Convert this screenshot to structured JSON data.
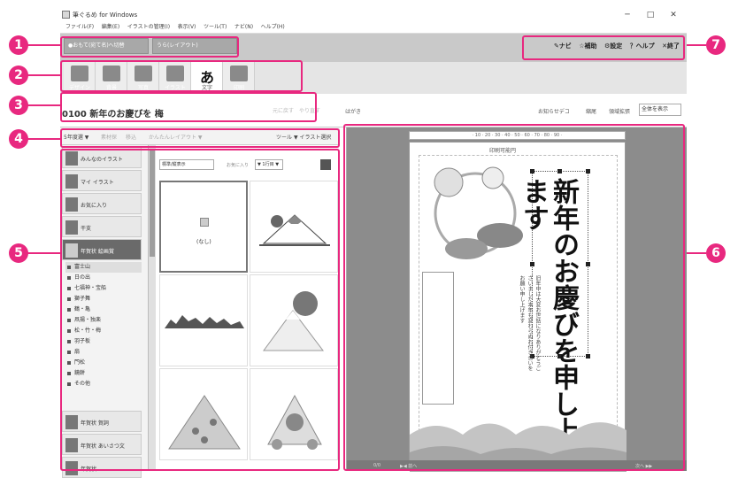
{
  "window": {
    "title": "筆ぐるめ for Windows",
    "min": "─",
    "max": "□",
    "close": "✕"
  },
  "menu": [
    "ファイル(F)",
    "編集(E)",
    "イラストの管理(I)",
    "表示(V)",
    "ツール(T)",
    "ナビ(N)",
    "ヘルプ(H)"
  ],
  "mode": {
    "front": "●おもて(宛て名)へ切替",
    "back": "うら(レイアウト)"
  },
  "toplinks": [
    "✎ナビ",
    "☆補助",
    "⚙設定",
    "？ヘルプ",
    "✕終了"
  ],
  "tools": [
    {
      "label": "デザイン",
      "icon": "design-icon"
    },
    {
      "label": "背景",
      "icon": "background-icon"
    },
    {
      "label": "写真",
      "icon": "photo-icon"
    },
    {
      "label": "イラスト",
      "icon": "illustration-icon"
    },
    {
      "label": "文字",
      "icon": "text-icon"
    },
    {
      "label": "印刷",
      "icon": "print-icon"
    }
  ],
  "title": {
    "number_name": "0100  新年のお慶びを  梅",
    "undo": "元に戻す",
    "redo": "やり直す",
    "side_label": "はがき",
    "r1": "お知らせデコ",
    "r2": "縮尾",
    "r3": "領域拡張",
    "select": "全体を表示"
  },
  "subbar": {
    "items": [
      "5年度選 ▼",
      "素材探",
      "移込",
      "かんたんレイアウト ▼"
    ],
    "right1": "ツール",
    "right2": "▼ イラスト選択"
  },
  "sidebar": {
    "items": [
      {
        "label": "みんなのイラスト"
      },
      {
        "label": "マイ イラスト"
      },
      {
        "label": "お気に入り"
      },
      {
        "label": "干支"
      },
      {
        "label": "年賀状 絵画賞"
      }
    ],
    "subitems": [
      "富士山",
      "日の出",
      "七福神・宝船",
      "獅子舞",
      "鶴・亀",
      "凧揚・独楽",
      "松・竹・梅",
      "羽子板",
      "扇",
      "門松",
      "鏡餅",
      "その他"
    ],
    "bottom": [
      {
        "label": "年賀状 賀詞"
      },
      {
        "label": "年賀状 あいさつ文"
      },
      {
        "label": "年賀状"
      }
    ]
  },
  "gallery": {
    "sel1": "標準/縦表示",
    "sel2": "お気に入り",
    "sel3": "▼ 1行目 ▼",
    "none_label": "(なし)"
  },
  "card": {
    "header": "印刷可能円",
    "greeting": "新年のお慶びを申し上げます",
    "pager": "0/0",
    "prev": "▶◀ 前へ",
    "next": "次へ ▶▶"
  },
  "callouts": [
    "1",
    "2",
    "3",
    "4",
    "5",
    "6",
    "7"
  ],
  "colors": {
    "accent": "#e8287f"
  }
}
